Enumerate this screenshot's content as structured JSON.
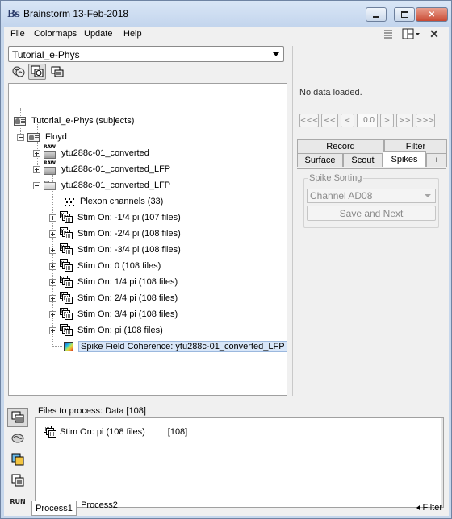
{
  "window": {
    "title": "Brainstorm 13-Feb-2018",
    "logo_text": "Bs"
  },
  "menu": {
    "items": [
      "File",
      "Colormaps",
      "Update",
      "Help"
    ]
  },
  "toolbar": {
    "icons": [
      "list-icon",
      "layout-icon",
      "close-icon"
    ]
  },
  "protocol": {
    "selected": "Tutorial_e-Phys"
  },
  "tree": {
    "root": "Tutorial_e-Phys (subjects)",
    "subject": "Floyd",
    "raw1": "ytu288c-01_converted",
    "raw2": "ytu288c-01_converted_LFP",
    "folder": "ytu288c-01_converted_LFP",
    "channels": "Plexon channels (33)",
    "conditions": [
      "Stim On: -1/4 pi (107 files)",
      "Stim On: -2/4 pi (108 files)",
      "Stim On: -3/4 pi (108 files)",
      "Stim On: 0 (108 files)",
      "Stim On: 1/4 pi (108 files)",
      "Stim On: 2/4 pi (108 files)",
      "Stim On: 3/4 pi (108 files)",
      "Stim On: pi (108 files)"
    ],
    "coherence": "Spike Field Coherence: ytu288c-01_converted_LFP"
  },
  "right": {
    "no_data": "No data loaded.",
    "nav": [
      "<<<",
      "<<",
      "<",
      "0.0",
      ">",
      ">>",
      ">>>"
    ],
    "tabs_row1": [
      "Record",
      "Filter"
    ],
    "tabs_row2": [
      "Surface",
      "Scout",
      "Spikes",
      "+"
    ],
    "active_tab": "Spikes",
    "spike_sorting": {
      "legend": "Spike Sorting",
      "channel": "Channel AD08",
      "button": "Save and Next"
    }
  },
  "process": {
    "header": "Files to process: Data [108]",
    "item_label": "Stim On: pi (108 files)",
    "item_count": "[108]",
    "tabs": [
      "Process1",
      "Process2"
    ],
    "filter": "Filter",
    "run": "RUN"
  }
}
